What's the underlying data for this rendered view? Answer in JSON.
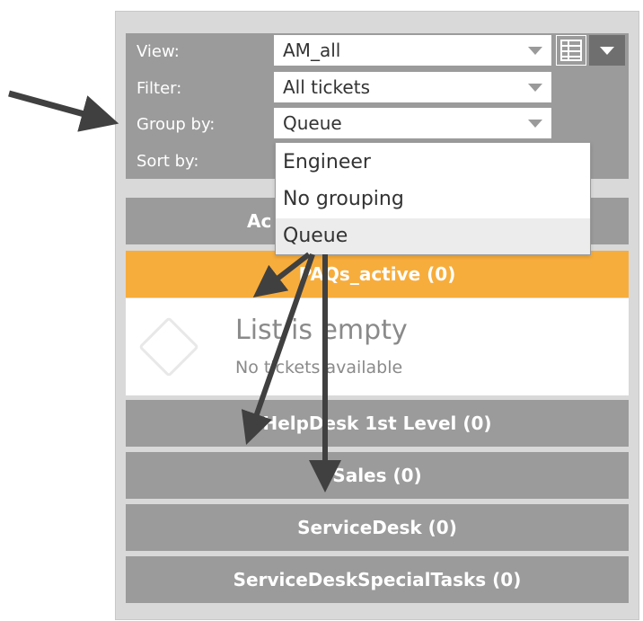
{
  "filters": {
    "view_label": "View:",
    "view_value": "AM_all",
    "filter_label": "Filter:",
    "filter_value": "All tickets",
    "group_label": "Group by:",
    "group_value": "Queue",
    "sort_label": "Sort by:"
  },
  "icons": {
    "layout": "grid-view-icon",
    "menu": "dropdown-menu-icon",
    "empty": "diamond-icon"
  },
  "dropdown": {
    "options": [
      "Engineer",
      "No grouping",
      "Queue"
    ],
    "selected": "Queue"
  },
  "groups": {
    "partial_header": "Ac",
    "active": "PAQs_active (0)",
    "helpdesk": "HelpDesk 1st Level (0)",
    "sales": "Sales (0)",
    "servicedesk": "ServiceDesk (0)",
    "special": "ServiceDeskSpecialTasks (0)"
  },
  "empty": {
    "title": "List is empty",
    "subtitle": "No tickets available"
  },
  "colors": {
    "panel": "#d9d9d9",
    "header_gray": "#9b9b9b",
    "active_orange": "#f7ad3c",
    "arrow": "#404040"
  }
}
